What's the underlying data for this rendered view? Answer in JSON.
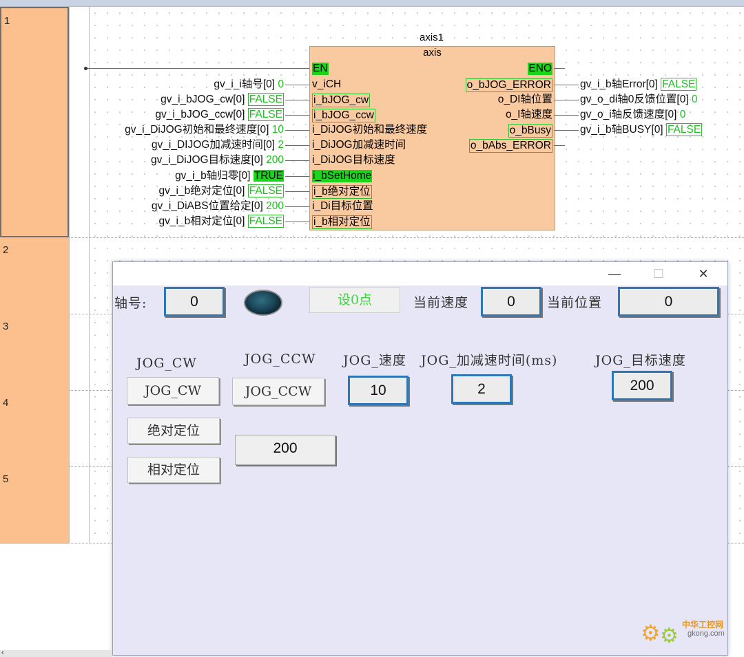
{
  "rungs": [
    "1",
    "2",
    "3",
    "4",
    "5"
  ],
  "fb": {
    "instance": "axis1",
    "type": "axis",
    "inputs": [
      "EN",
      "v_iCH",
      "i_bJOG_cw",
      "i_bJOG_ccw",
      "i_DiJOG初始和最终速度",
      "i_DiJOG加减速时间",
      "i_DiJOG目标速度",
      "i_bSetHome",
      "i_b绝对定位",
      "i_Di目标位置",
      "i_b相对定位"
    ],
    "outputs": [
      "ENO",
      "o_bJOG_ERROR",
      "o_DI轴位置",
      "o_I轴速度",
      "o_bBusy",
      "o_bAbs_ERROR"
    ]
  },
  "in_vars": [
    {
      "name": "gv_i_i轴号[0]",
      "value": "0"
    },
    {
      "name": "gv_i_bJOG_cw[0]",
      "value": "FALSE"
    },
    {
      "name": "gv_i_bJOG_ccw[0]",
      "value": "FALSE"
    },
    {
      "name": "gv_i_DiJOG初始和最终速度[0]",
      "value": "10"
    },
    {
      "name": "gv_i_DIJOG加减速时间[0]",
      "value": "2"
    },
    {
      "name": "gv_i_DiJOG目标速度[0]",
      "value": "200"
    },
    {
      "name": "gv_i_b轴归零[0]",
      "value": "TRUE"
    },
    {
      "name": "gv_i_b绝对定位[0]",
      "value": "FALSE"
    },
    {
      "name": "gv_i_DiABS位置给定[0]",
      "value": "200"
    },
    {
      "name": "gv_i_b相对定位[0]",
      "value": "FALSE"
    }
  ],
  "out_vars": [
    {
      "name": "gv_i_b轴Error[0]",
      "value": "FALSE"
    },
    {
      "name": "gv_o_di轴0反馈位置[0]",
      "value": "0"
    },
    {
      "name": "gv_o_i轴反馈速度[0]",
      "value": "0"
    },
    {
      "name": "gv_i_b轴BUSY[0]",
      "value": "FALSE"
    }
  ],
  "dialog": {
    "minimize": "—",
    "maximize": "☐",
    "close": "✕",
    "axis_label": "轴号:",
    "axis_value": "0",
    "set_zero": "设0点",
    "cur_speed_label": "当前速度",
    "cur_speed_value": "0",
    "cur_pos_label": "当前位置",
    "cur_pos_value": "0",
    "jog_cw_label": "JOG_CW",
    "jog_ccw_label": "JOG_CCW",
    "jog_speed_label": "JOG_速度",
    "jog_acc_label": "JOG_加减速时间(ms)",
    "jog_target_label": "JOG_目标速度",
    "jog_cw_button": "JOG_CW",
    "jog_ccw_button": "JOG_CCW",
    "jog_speed_value": "10",
    "jog_acc_value": "2",
    "jog_target_value": "200",
    "abs_button": "绝对定位",
    "rel_button": "相对定位",
    "abs_pos_value": "200"
  },
  "watermark": {
    "line1": "中华工控网",
    "line2": "gkong.com"
  }
}
